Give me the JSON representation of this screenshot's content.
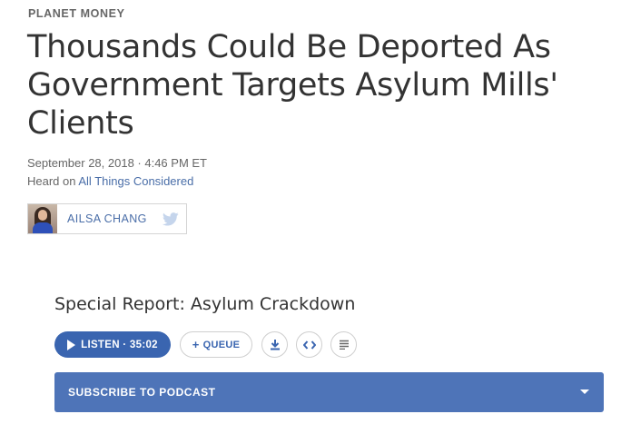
{
  "section": {
    "label": "PLANET MONEY"
  },
  "article": {
    "title": "Thousands Could Be Deported As Government Targets Asylum Mills' Clients",
    "date": "September 28, 2018 · 4:46 PM ET",
    "heard_prefix": "Heard on ",
    "program": "All Things Considered"
  },
  "byline": {
    "author": "AILSA CHANG",
    "social_icon": "twitter-icon"
  },
  "audio": {
    "report_title": "Special Report: Asylum Crackdown",
    "listen_label": "LISTEN · 35:02",
    "queue_label": "QUEUE",
    "icons": [
      "play-icon",
      "plus-icon",
      "download-icon",
      "embed-icon",
      "transcript-icon",
      "chevron-down-icon"
    ]
  },
  "subscribe": {
    "label": "SUBSCRIBE TO PODCAST"
  },
  "colors": {
    "accent": "#3a65b0",
    "link": "#4a6ea8",
    "subscribe_bg": "#4e74b8",
    "text": "#333333",
    "muted": "#666666"
  }
}
